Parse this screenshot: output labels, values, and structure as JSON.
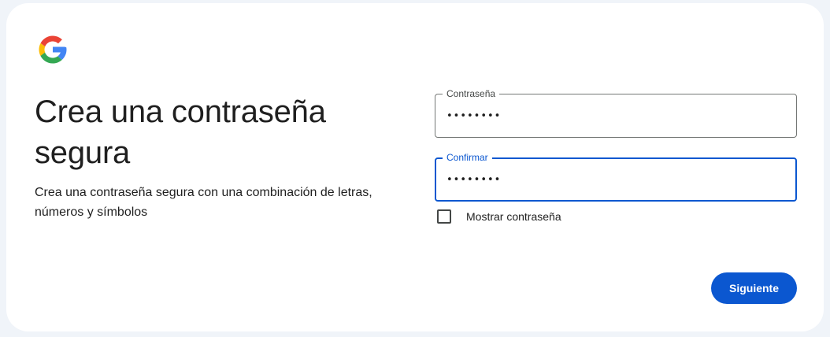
{
  "brand": {
    "logo_icon": "google-g-logo",
    "colors": {
      "blue": "#4285F4",
      "red": "#EA4335",
      "yellow": "#FBBC05",
      "green": "#34A853"
    }
  },
  "header": {
    "title": "Crea una contraseña segura",
    "subtitle": "Crea una contraseña segura con una combinación de letras, números y símbolos"
  },
  "form": {
    "password": {
      "label": "Contraseña",
      "value": "••••••••"
    },
    "confirm": {
      "label": "Confirmar",
      "value": "••••••••",
      "focused": true
    },
    "show_password": {
      "label": "Mostrar contraseña",
      "checked": false
    }
  },
  "actions": {
    "next_label": "Siguiente"
  },
  "theme": {
    "accent": "#0b57d0",
    "page_background": "#f0f4f9",
    "card_background": "#ffffff",
    "text": "#1f1f1f"
  }
}
